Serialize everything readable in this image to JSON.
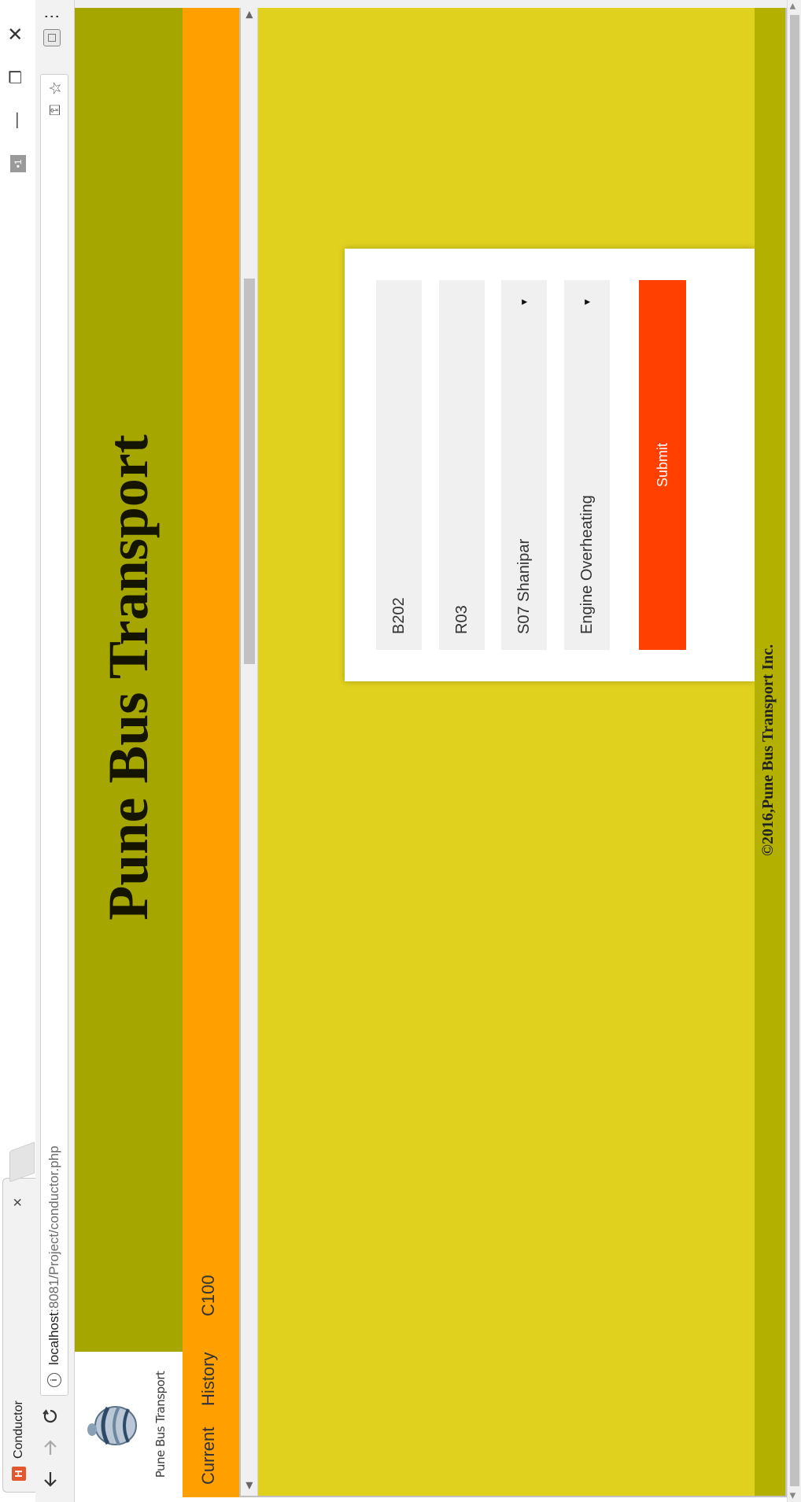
{
  "browser": {
    "tab_title": "Conductor",
    "tab_close": "×",
    "favicon_letter": "H",
    "url_host": "localhost",
    "url_path": ":8081/Project/conductor.php",
    "menu_dots": "⋮",
    "win_min": "—",
    "win_restore": "❐",
    "win_close": "✕",
    "profile_glyph": "•1"
  },
  "site": {
    "logo_caption": "Pune Bus Transport",
    "title": "Pune Bus Transport",
    "nav": {
      "current": "Current",
      "history": "History",
      "conductor_id": "C100"
    },
    "footer": "©2016,Pune Bus Transport Inc."
  },
  "form": {
    "bus_value": "B202",
    "route_value": "R03",
    "stop_value": "S07 Shanipar",
    "issue_value": "Engine Overheating",
    "submit_label": "Submit"
  },
  "colors": {
    "header_bg": "#a5a600",
    "nav_bg": "#ffa000",
    "frame_bg": "#e1d11f",
    "footer_bg": "#b3b000",
    "submit_bg": "#ff4000",
    "field_bg": "#f0f0f0"
  },
  "icons": {
    "back": "arrow-left-icon",
    "forward": "arrow-right-icon",
    "reload": "reload-icon",
    "info": "info-icon",
    "bookmark": "star-icon",
    "key": "key-icon",
    "extension": "extension-icon",
    "menu": "more-vert-icon",
    "dropdown": "triangle-down-icon"
  }
}
